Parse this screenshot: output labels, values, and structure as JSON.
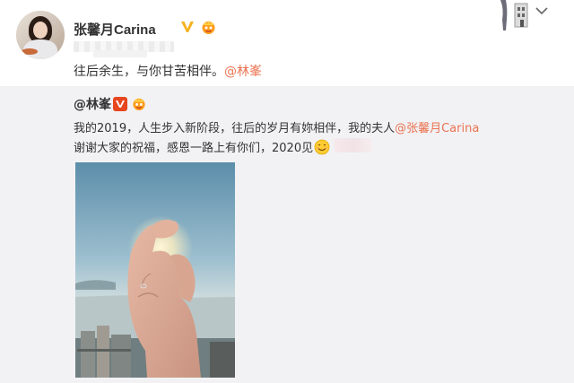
{
  "post": {
    "username": "张馨月Carina",
    "text_prefix": "往后余生，与你甘苦相伴。",
    "mention": "@林峯"
  },
  "repost": {
    "username": "@林峯",
    "line1_prefix": "我的2019，人生步入新阶段，往后的岁月有妳相伴，我的夫人",
    "line1_mention": "@张馨月Carina",
    "line2_text": "谢谢大家的祝福，感恩一路上有你们，2020见"
  },
  "icons": {
    "verified": "verified-v-icon",
    "vip": "vip-crown-icon",
    "smile": "smile-emoji-icon",
    "more": "chevron-down-icon"
  },
  "colors": {
    "mention": "#eb7350",
    "repost_bg": "#f2f2f5",
    "verified_yellow": "#f5b21e",
    "verified_red": "#e8461e"
  }
}
